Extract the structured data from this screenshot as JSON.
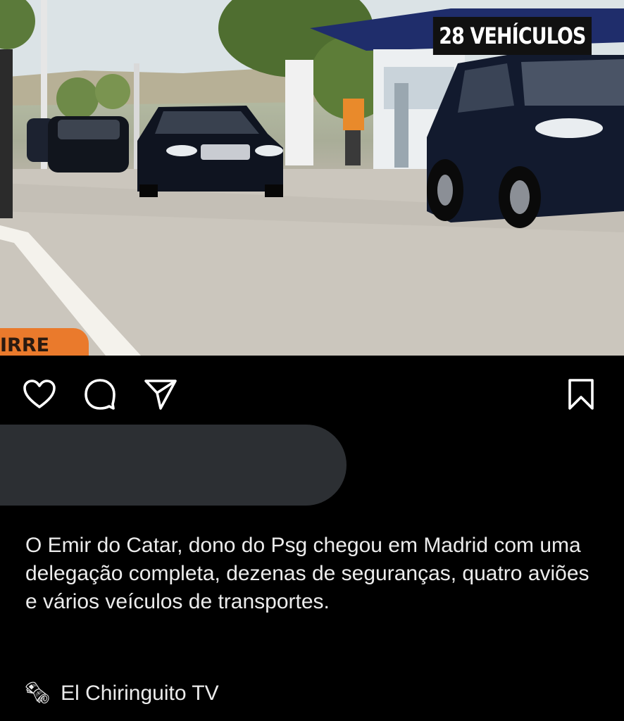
{
  "post": {
    "overlay_caption": "28 VEHÍCULOS",
    "lower_tag": "IRRE",
    "redacted_comment": ""
  },
  "actions": {
    "like": "heart-icon",
    "comment": "comment-icon",
    "share": "send-icon",
    "save": "bookmark-icon"
  },
  "caption": {
    "text": "O Emir do Catar, dono do Psg chegou em Madrid com uma delegação completa, dezenas de seguranças, quatro aviões e vários veículos de transportes."
  },
  "source": {
    "icon": "rolled-newspaper-icon",
    "emoji": "🗞",
    "name": "El Chiringuito TV"
  }
}
